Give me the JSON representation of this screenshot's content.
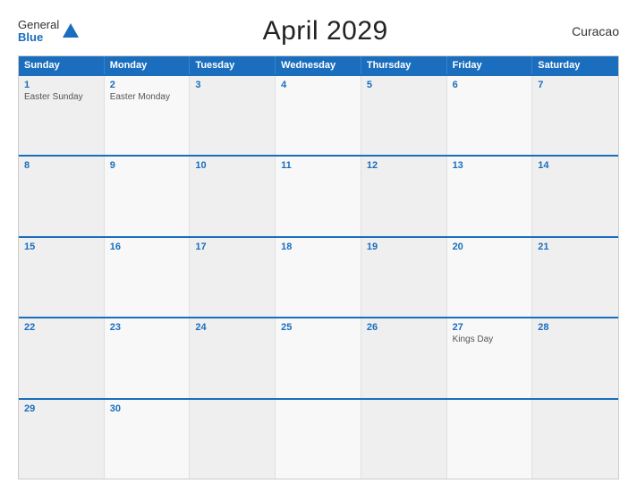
{
  "header": {
    "logo_general": "General",
    "logo_blue": "Blue",
    "title": "April 2029",
    "country": "Curacao"
  },
  "days": [
    "Sunday",
    "Monday",
    "Tuesday",
    "Wednesday",
    "Thursday",
    "Friday",
    "Saturday"
  ],
  "weeks": [
    [
      {
        "num": "1",
        "event": "Easter Sunday"
      },
      {
        "num": "2",
        "event": "Easter Monday"
      },
      {
        "num": "3",
        "event": ""
      },
      {
        "num": "4",
        "event": ""
      },
      {
        "num": "5",
        "event": ""
      },
      {
        "num": "6",
        "event": ""
      },
      {
        "num": "7",
        "event": ""
      }
    ],
    [
      {
        "num": "8",
        "event": ""
      },
      {
        "num": "9",
        "event": ""
      },
      {
        "num": "10",
        "event": ""
      },
      {
        "num": "11",
        "event": ""
      },
      {
        "num": "12",
        "event": ""
      },
      {
        "num": "13",
        "event": ""
      },
      {
        "num": "14",
        "event": ""
      }
    ],
    [
      {
        "num": "15",
        "event": ""
      },
      {
        "num": "16",
        "event": ""
      },
      {
        "num": "17",
        "event": ""
      },
      {
        "num": "18",
        "event": ""
      },
      {
        "num": "19",
        "event": ""
      },
      {
        "num": "20",
        "event": ""
      },
      {
        "num": "21",
        "event": ""
      }
    ],
    [
      {
        "num": "22",
        "event": ""
      },
      {
        "num": "23",
        "event": ""
      },
      {
        "num": "24",
        "event": ""
      },
      {
        "num": "25",
        "event": ""
      },
      {
        "num": "26",
        "event": ""
      },
      {
        "num": "27",
        "event": "Kings Day"
      },
      {
        "num": "28",
        "event": ""
      }
    ],
    [
      {
        "num": "29",
        "event": ""
      },
      {
        "num": "30",
        "event": ""
      },
      {
        "num": "",
        "event": ""
      },
      {
        "num": "",
        "event": ""
      },
      {
        "num": "",
        "event": ""
      },
      {
        "num": "",
        "event": ""
      },
      {
        "num": "",
        "event": ""
      }
    ]
  ]
}
